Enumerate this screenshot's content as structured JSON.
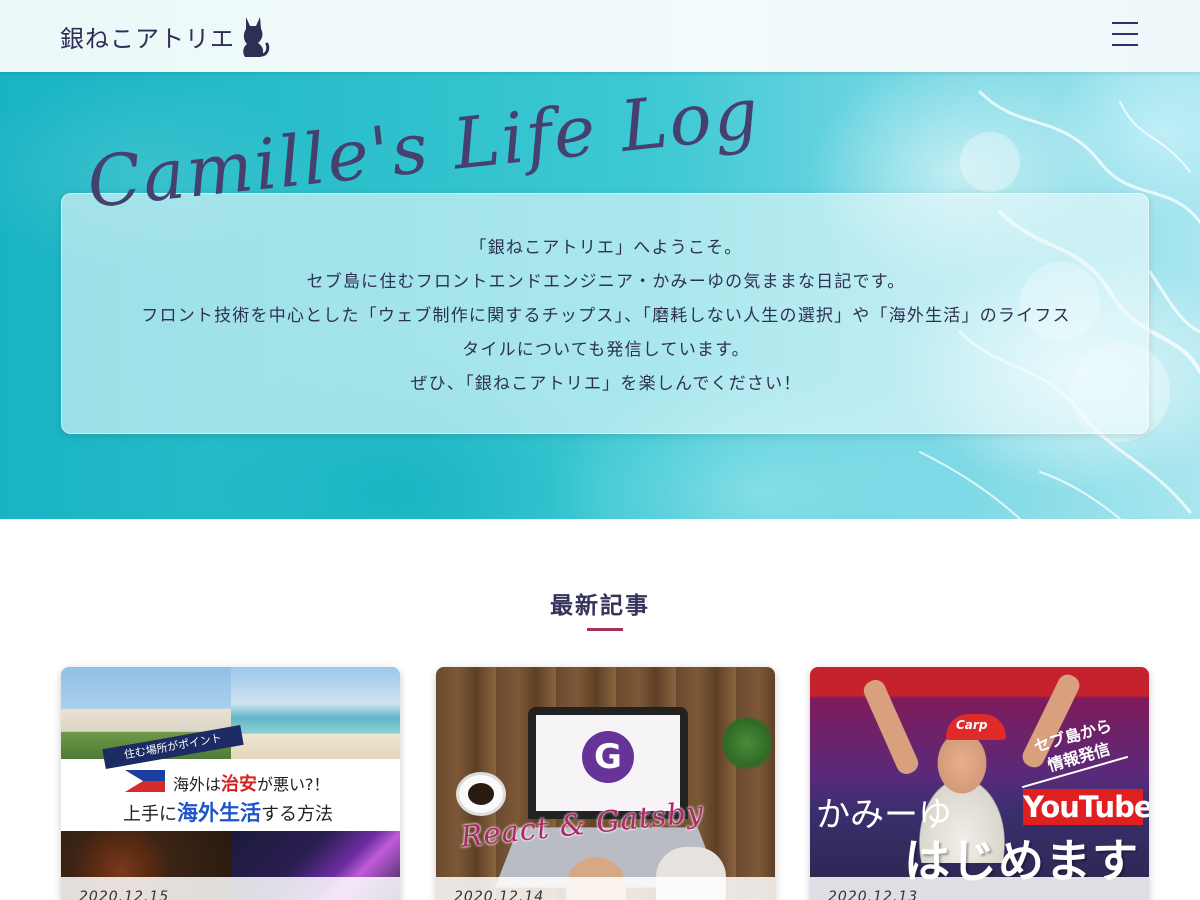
{
  "header": {
    "logo_text": "銀ねこアトリエ",
    "logo_icon": "cat-silhouette-icon",
    "menu_icon": "hamburger-menu-icon"
  },
  "hero": {
    "script_title": "Camille's Life Log",
    "lines": [
      "「銀ねこアトリエ」へようこそ。",
      "セブ島に住むフロントエンドエンジニア・かみーゆの気ままな日記です。",
      "フロント技術を中心とした「ウェブ制作に関するチップス」、「磨耗しない人生の選択」や「海外生活」のライフス",
      "タイルについても発信しています。",
      "ぜひ、「銀ねこアトリエ」を楽しんでください！"
    ]
  },
  "latest": {
    "title": "最新記事",
    "accent_color": "#a8305e"
  },
  "posts": [
    {
      "date": "2020.12.15",
      "thumb": {
        "ribbon": "住む場所がポイント",
        "line1_a": "海外は",
        "line1_red": "治安",
        "line1_b": "が悪い?！",
        "line2_a": "上手に",
        "line2_blue": "海外生活",
        "line2_b": "する方法"
      }
    },
    {
      "date": "2020.12.14",
      "thumb": {
        "logo_letter": "G",
        "script": "React & Gatsby"
      }
    },
    {
      "date": "2020.12.13",
      "thumb": {
        "tag_line1": "セブ島から",
        "tag_line2": "情報発信",
        "name": "かみーゆ",
        "badge": "YouTube",
        "main": "はじめます",
        "cap_text": "Carp"
      }
    }
  ],
  "colors": {
    "navy_text": "#2d2f55",
    "ocean": "#2cc0cc"
  }
}
